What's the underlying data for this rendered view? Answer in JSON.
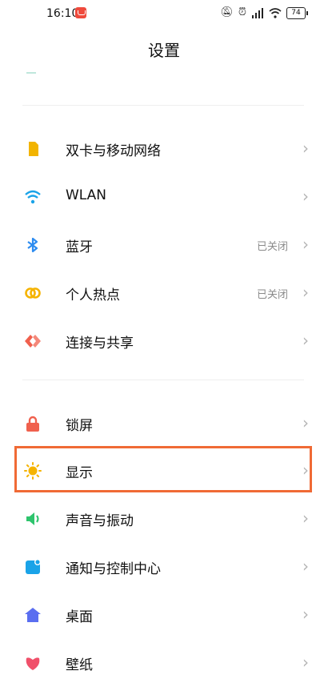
{
  "status_bar": {
    "time": "16:10",
    "battery": "74"
  },
  "header": {
    "title": "设置"
  },
  "sections": [
    {
      "items": [
        {
          "label": "双卡与移动网络",
          "status": "",
          "icon": "sim-card-icon",
          "color": "#f2b400"
        },
        {
          "label": "WLAN",
          "status": "",
          "icon": "wifi-icon",
          "color": "#1aa3e8"
        },
        {
          "label": "蓝牙",
          "status": "已关闭",
          "icon": "bluetooth-icon",
          "color": "#2d8cf0"
        },
        {
          "label": "个人热点",
          "status": "已关闭",
          "icon": "hotspot-icon",
          "color": "#f5b300"
        },
        {
          "label": "连接与共享",
          "status": "",
          "icon": "share-icon",
          "color": "#f0604d"
        }
      ]
    },
    {
      "items": [
        {
          "label": "锁屏",
          "status": "",
          "icon": "lock-icon",
          "color": "#f0604d"
        },
        {
          "label": "显示",
          "status": "",
          "icon": "sun-icon",
          "color": "#f5b300",
          "highlighted": true
        },
        {
          "label": "声音与振动",
          "status": "",
          "icon": "speaker-icon",
          "color": "#2ec46d"
        },
        {
          "label": "通知与控制中心",
          "status": "",
          "icon": "notification-icon",
          "color": "#1aa3e8"
        },
        {
          "label": "桌面",
          "status": "",
          "icon": "home-icon",
          "color": "#5a6ef0"
        },
        {
          "label": "壁纸",
          "status": "",
          "icon": "wallpaper-icon",
          "color": "#f0506a"
        }
      ]
    }
  ]
}
